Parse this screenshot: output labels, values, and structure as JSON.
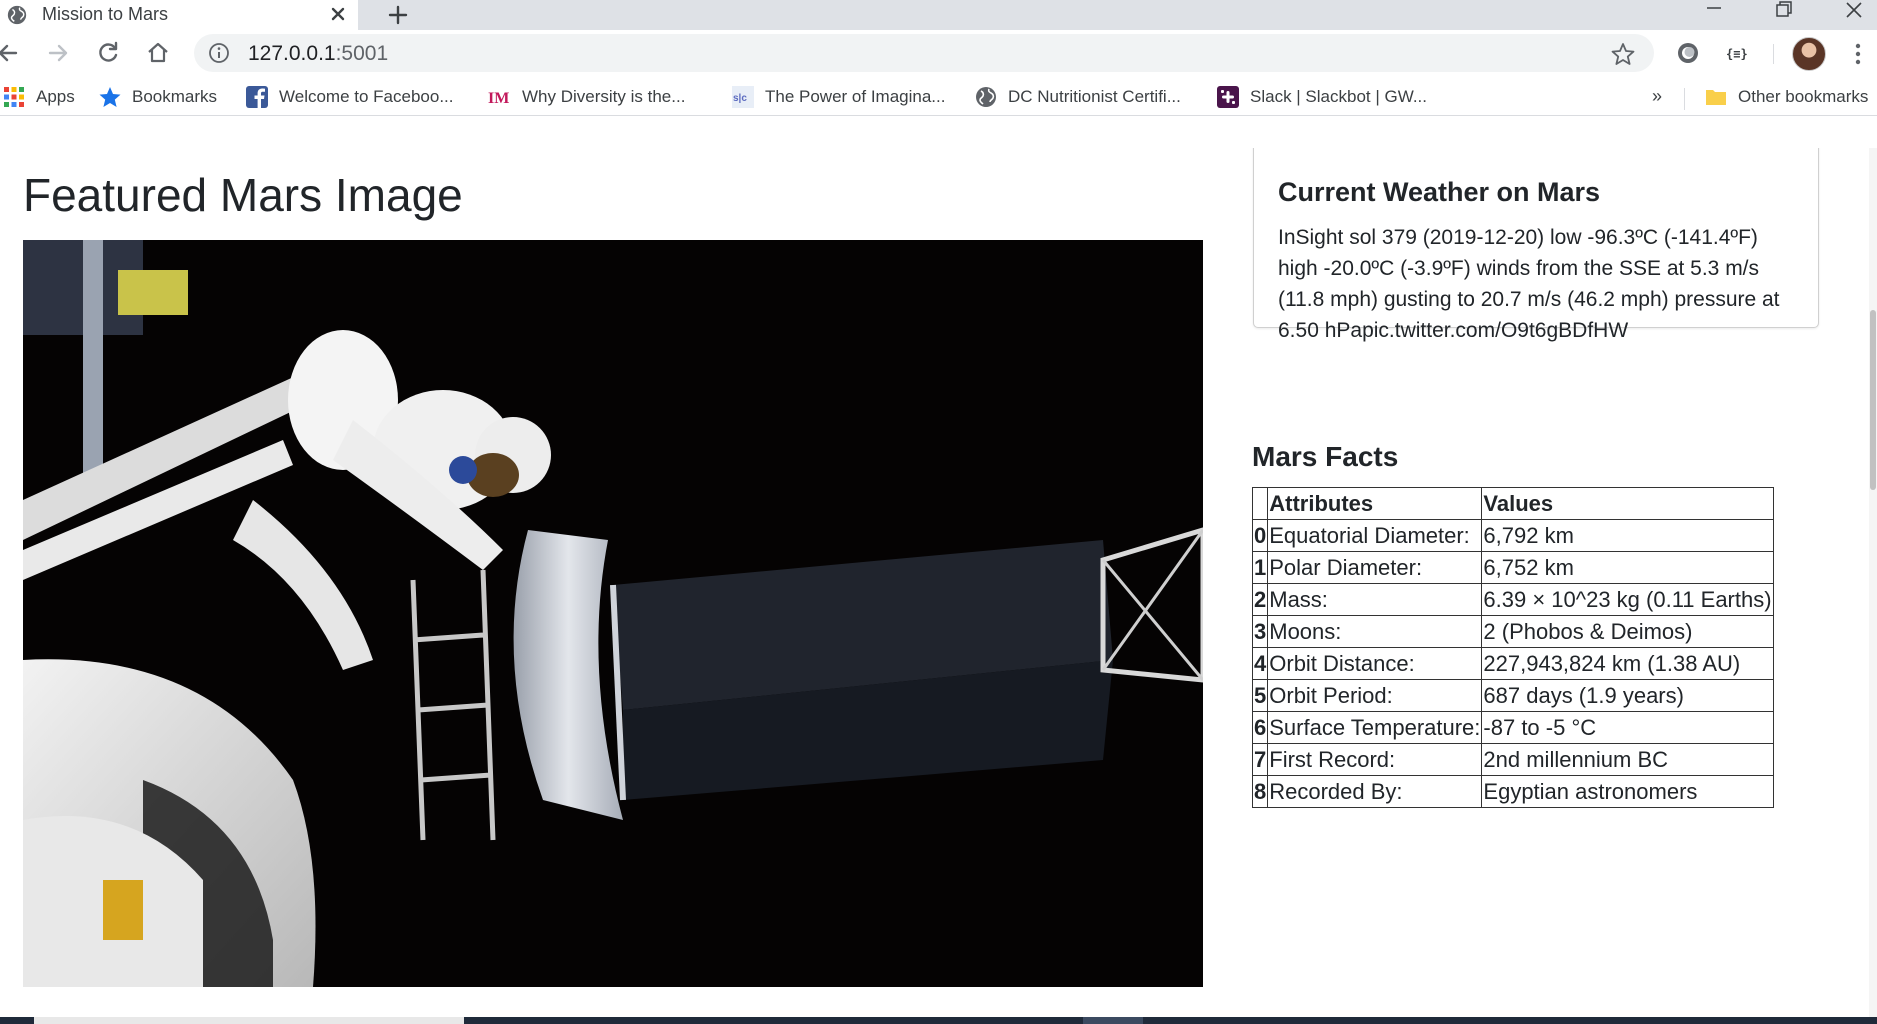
{
  "browser": {
    "tab": {
      "title": "Mission to Mars"
    },
    "address": {
      "host": "127.0.0.1",
      "port": ":5001"
    },
    "bookmarks": [
      {
        "label": "Apps",
        "icon": "apps-grid-icon"
      },
      {
        "label": "Bookmarks",
        "icon": "star-icon"
      },
      {
        "label": "Welcome to Faceboo...",
        "icon": "facebook-icon"
      },
      {
        "label": "Why Diversity is the...",
        "icon": "im-icon"
      },
      {
        "label": "The Power of Imagina...",
        "icon": "site-icon"
      },
      {
        "label": "DC Nutritionist Certifi...",
        "icon": "globe-icon"
      },
      {
        "label": "Slack | Slackbot | GW...",
        "icon": "slack-icon"
      }
    ],
    "bookmarks_more": "»",
    "other_bookmarks": "Other bookmarks"
  },
  "featured": {
    "title": "Featured Mars Image"
  },
  "weather": {
    "title": "Current Weather on Mars",
    "text": "InSight sol 379 (2019-12-20) low -96.3ºC (-141.4ºF) high -20.0ºC (-3.9ºF) winds from the SSE at 5.3 m/s (11.8 mph) gusting to 20.7 m/s (46.2 mph) pressure at 6.50 hPapic.twitter.com/O9t6gBDfHW"
  },
  "facts": {
    "title": "Mars Facts",
    "headers": {
      "index": "",
      "attribute": "Attributes",
      "value": "Values"
    },
    "rows": [
      {
        "index": "0",
        "attribute": "Equatorial Diameter:",
        "value": "6,792 km"
      },
      {
        "index": "1",
        "attribute": "Polar Diameter:",
        "value": "6,752 km"
      },
      {
        "index": "2",
        "attribute": "Mass:",
        "value": "6.39 × 10^23 kg (0.11 Earths)"
      },
      {
        "index": "3",
        "attribute": "Moons:",
        "value": "2 (Phobos & Deimos)"
      },
      {
        "index": "4",
        "attribute": "Orbit Distance:",
        "value": "227,943,824 km (1.38 AU)"
      },
      {
        "index": "5",
        "attribute": "Orbit Period:",
        "value": "687 days (1.9 years)"
      },
      {
        "index": "6",
        "attribute": "Surface Temperature:",
        "value": "-87 to -5 °C"
      },
      {
        "index": "7",
        "attribute": "First Record:",
        "value": "2nd millennium BC"
      },
      {
        "index": "8",
        "attribute": "Recorded By:",
        "value": "Egyptian astronomers"
      }
    ]
  },
  "colors": {
    "tab_strip": "#dee1e6",
    "omnibox": "#f1f3f4",
    "bookmark_star": "#1a73e8",
    "facebook": "#3b5998",
    "im_brand": "#c2185b",
    "folder": "#f9cf4a"
  }
}
